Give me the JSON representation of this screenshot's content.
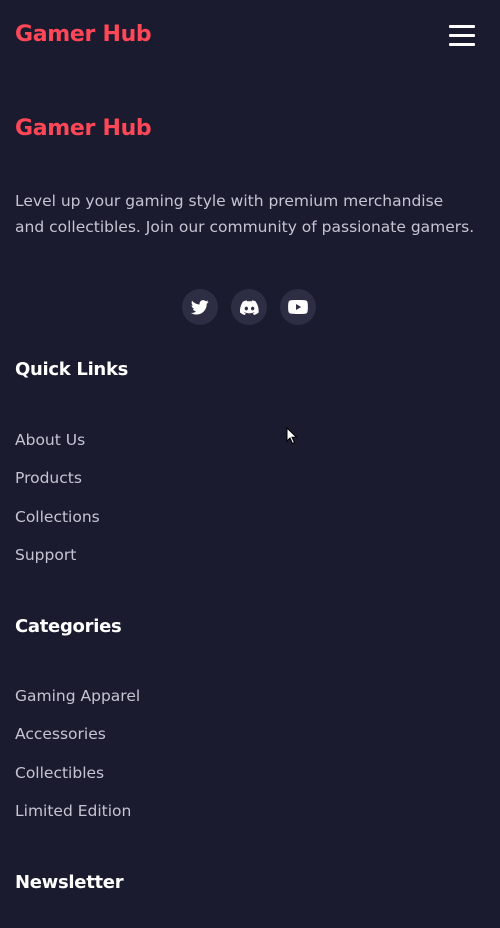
{
  "header": {
    "brand": "Gamer Hub",
    "menu_icon": "hamburger-menu-icon"
  },
  "footer": {
    "brand": "Gamer Hub",
    "tagline": "Level up your gaming style with premium merchandise and collectibles. Join our community of passionate gamers.",
    "social": [
      {
        "icon": "twitter-icon"
      },
      {
        "icon": "discord-icon"
      },
      {
        "icon": "youtube-icon"
      }
    ],
    "quick_links": {
      "title": "Quick Links",
      "items": [
        "About Us",
        "Products",
        "Collections",
        "Support"
      ]
    },
    "categories": {
      "title": "Categories",
      "items": [
        "Gaming Apparel",
        "Accessories",
        "Collectibles",
        "Limited Edition"
      ]
    },
    "newsletter": {
      "title": "Newsletter"
    }
  },
  "colors": {
    "background": "#1b1b2f",
    "brand": "#ff4757",
    "text_muted": "#c4c4d2",
    "icon_bg": "#2d2d43",
    "heading": "#ffffff"
  }
}
